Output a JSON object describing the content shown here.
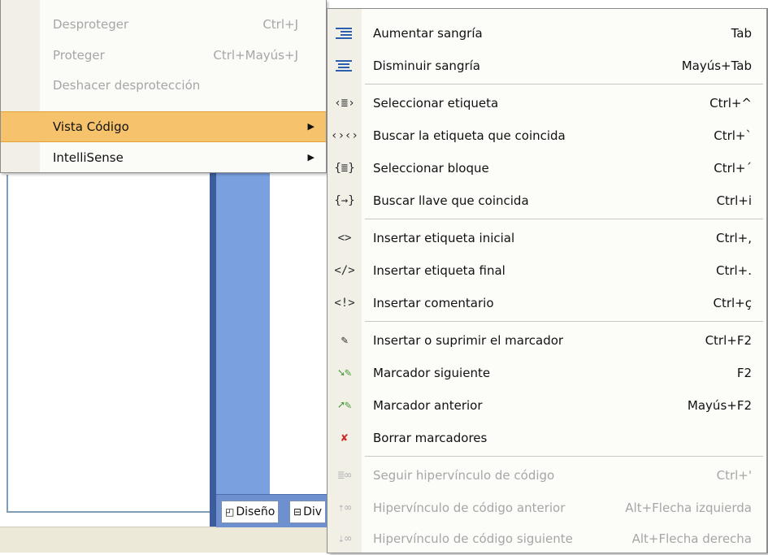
{
  "background": {
    "tabs": [
      {
        "label": "Diseño",
        "icon": "design-tab-icon"
      },
      {
        "label": "Div",
        "icon": "split-tab-icon"
      }
    ]
  },
  "parent_menu": {
    "items": [
      {
        "label": "Desproteger",
        "shortcut": "Ctrl+J",
        "disabled": true
      },
      {
        "label": "Proteger",
        "shortcut": "Ctrl+Mayús+J",
        "disabled": true
      },
      {
        "label": "Deshacer desprotección",
        "shortcut": "",
        "disabled": true
      },
      {
        "label": "Vista Código",
        "shortcut": "",
        "submenu": true,
        "highlighted": true
      },
      {
        "label": "IntelliSense",
        "shortcut": "",
        "submenu": true
      }
    ]
  },
  "submenu": {
    "items": [
      {
        "label": "Aumentar sangría",
        "shortcut": "Tab",
        "icon": "indent-increase-icon"
      },
      {
        "label": "Disminuir sangría",
        "shortcut": "Mayús+Tab",
        "icon": "indent-decrease-icon"
      },
      {
        "label": "Seleccionar etiqueta",
        "shortcut": "Ctrl+^",
        "icon": "select-tag-icon"
      },
      {
        "label": "Buscar la etiqueta que coincida",
        "shortcut": "Ctrl+`",
        "icon": "match-tag-icon"
      },
      {
        "label": "Seleccionar bloque",
        "shortcut": "Ctrl+´",
        "icon": "select-block-icon"
      },
      {
        "label": "Buscar llave que coincida",
        "shortcut": "Ctrl+i",
        "icon": "match-brace-icon"
      },
      {
        "label": "Insertar etiqueta inicial",
        "shortcut": "Ctrl+,",
        "icon": "start-tag-icon"
      },
      {
        "label": "Insertar etiqueta final",
        "shortcut": "Ctrl+.",
        "icon": "end-tag-icon"
      },
      {
        "label": "Insertar comentario",
        "shortcut": "Ctrl+ç",
        "icon": "comment-icon"
      },
      {
        "label": "Insertar o suprimir el marcador",
        "shortcut": "Ctrl+F2",
        "icon": "bookmark-toggle-icon"
      },
      {
        "label": "Marcador siguiente",
        "shortcut": "F2",
        "icon": "bookmark-next-icon"
      },
      {
        "label": "Marcador anterior",
        "shortcut": "Mayús+F2",
        "icon": "bookmark-prev-icon"
      },
      {
        "label": "Borrar marcadores",
        "shortcut": "",
        "icon": "bookmark-clear-icon"
      },
      {
        "label": "Seguir hipervínculo de código",
        "shortcut": "Ctrl+'",
        "icon": "follow-link-icon",
        "disabled": true
      },
      {
        "label": "Hipervínculo de código anterior",
        "shortcut": "Alt+Flecha izquierda",
        "icon": "prev-link-icon",
        "disabled": true
      },
      {
        "label": "Hipervínculo de código siguiente",
        "shortcut": "Alt+Flecha derecha",
        "icon": "next-link-icon",
        "disabled": true
      }
    ]
  },
  "colors": {
    "highlight": "#f6c26b",
    "disabled_text": "#a6a6a6",
    "frame_blue": "#3b5d9c"
  }
}
